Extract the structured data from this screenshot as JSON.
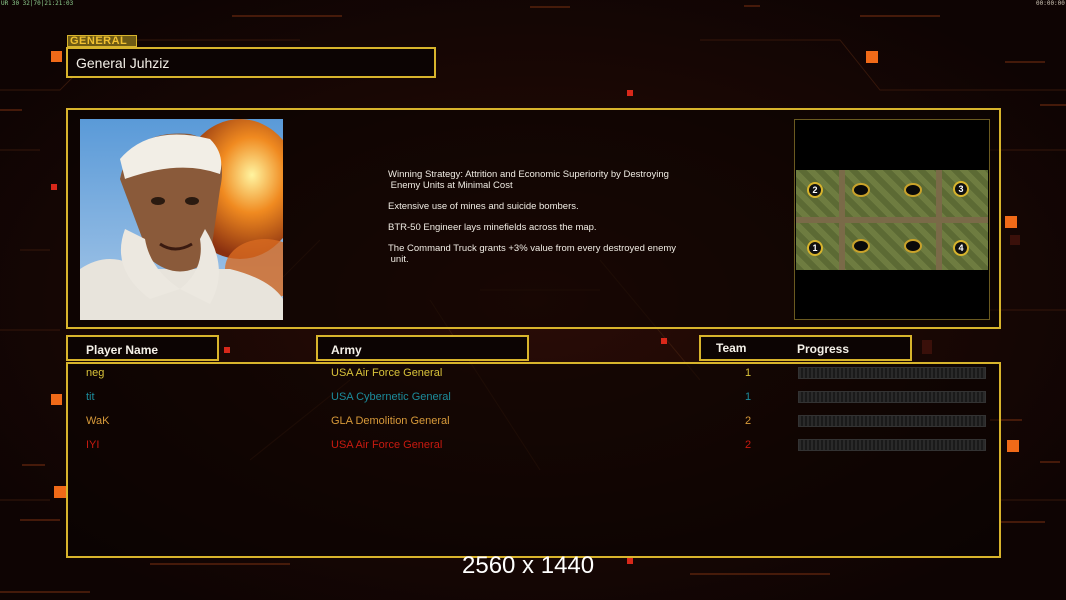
{
  "status_bar": {
    "left": "UR 30 32|70|21:21:03",
    "right": "00:00:00"
  },
  "section_tab": "GENERAL",
  "general_name": "General Juhziz",
  "description": [
    "Winning Strategy: Attrition and Economic Superiority by Destroying\n Enemy Units at Minimal Cost",
    "Extensive use of mines and suicide bombers.",
    "BTR-50 Engineer lays minefields across the map.",
    "The Command Truck grants +3% value from every destroyed enemy\n unit."
  ],
  "map": {
    "slots": [
      "2",
      "3",
      "1",
      "4"
    ]
  },
  "table": {
    "headers": {
      "player": "Player Name",
      "army": "Army",
      "team": "Team",
      "progress": "Progress"
    },
    "rows": [
      {
        "player": "neg",
        "army": "USA Air Force General",
        "team": "1",
        "progress": 0,
        "color": "#d8c23a"
      },
      {
        "player": "tit",
        "army": "USA Cybernetic General",
        "team": "1",
        "progress": 0,
        "color": "#1c8c9c"
      },
      {
        "player": "WaK",
        "army": "GLA Demolition General",
        "team": "2",
        "progress": 0,
        "color": "#d89a3a"
      },
      {
        "player": "IYI",
        "army": "USA Air Force General",
        "team": "2",
        "progress": 0,
        "color": "#c81a10"
      }
    ]
  },
  "resolution_label": "2560 x 1440",
  "colors": {
    "accent": "#d8b42c",
    "background": "#140604",
    "orange": "#ff6a10"
  }
}
